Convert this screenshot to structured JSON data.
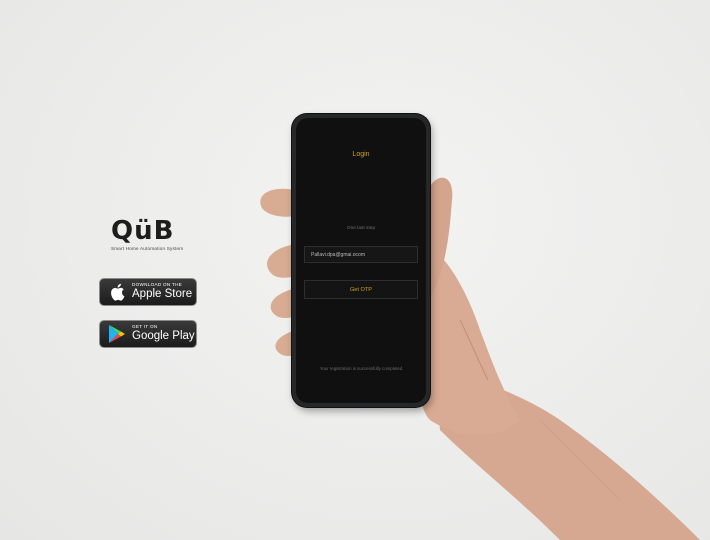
{
  "brand": {
    "logo_text": "QüB",
    "tagline": "Smart Home Automation System"
  },
  "badges": {
    "apple": {
      "small_text": "DOWNLOAD ON THE",
      "big_text": "Apple Store",
      "icon": "apple-icon"
    },
    "google": {
      "small_text": "GET IT ON",
      "big_text": "Google Play",
      "icon": "play-icon"
    }
  },
  "app": {
    "title": "Login",
    "step_label": "One last step",
    "email_value": "Pallavi.dpa@gmai.ocom",
    "otp_button_label": "Get OTP",
    "registration_note": "Your registration is successfully completed"
  },
  "colors": {
    "accent": "#d6a21e",
    "screen_bg": "#101010",
    "page_bg": "#ececeb"
  }
}
